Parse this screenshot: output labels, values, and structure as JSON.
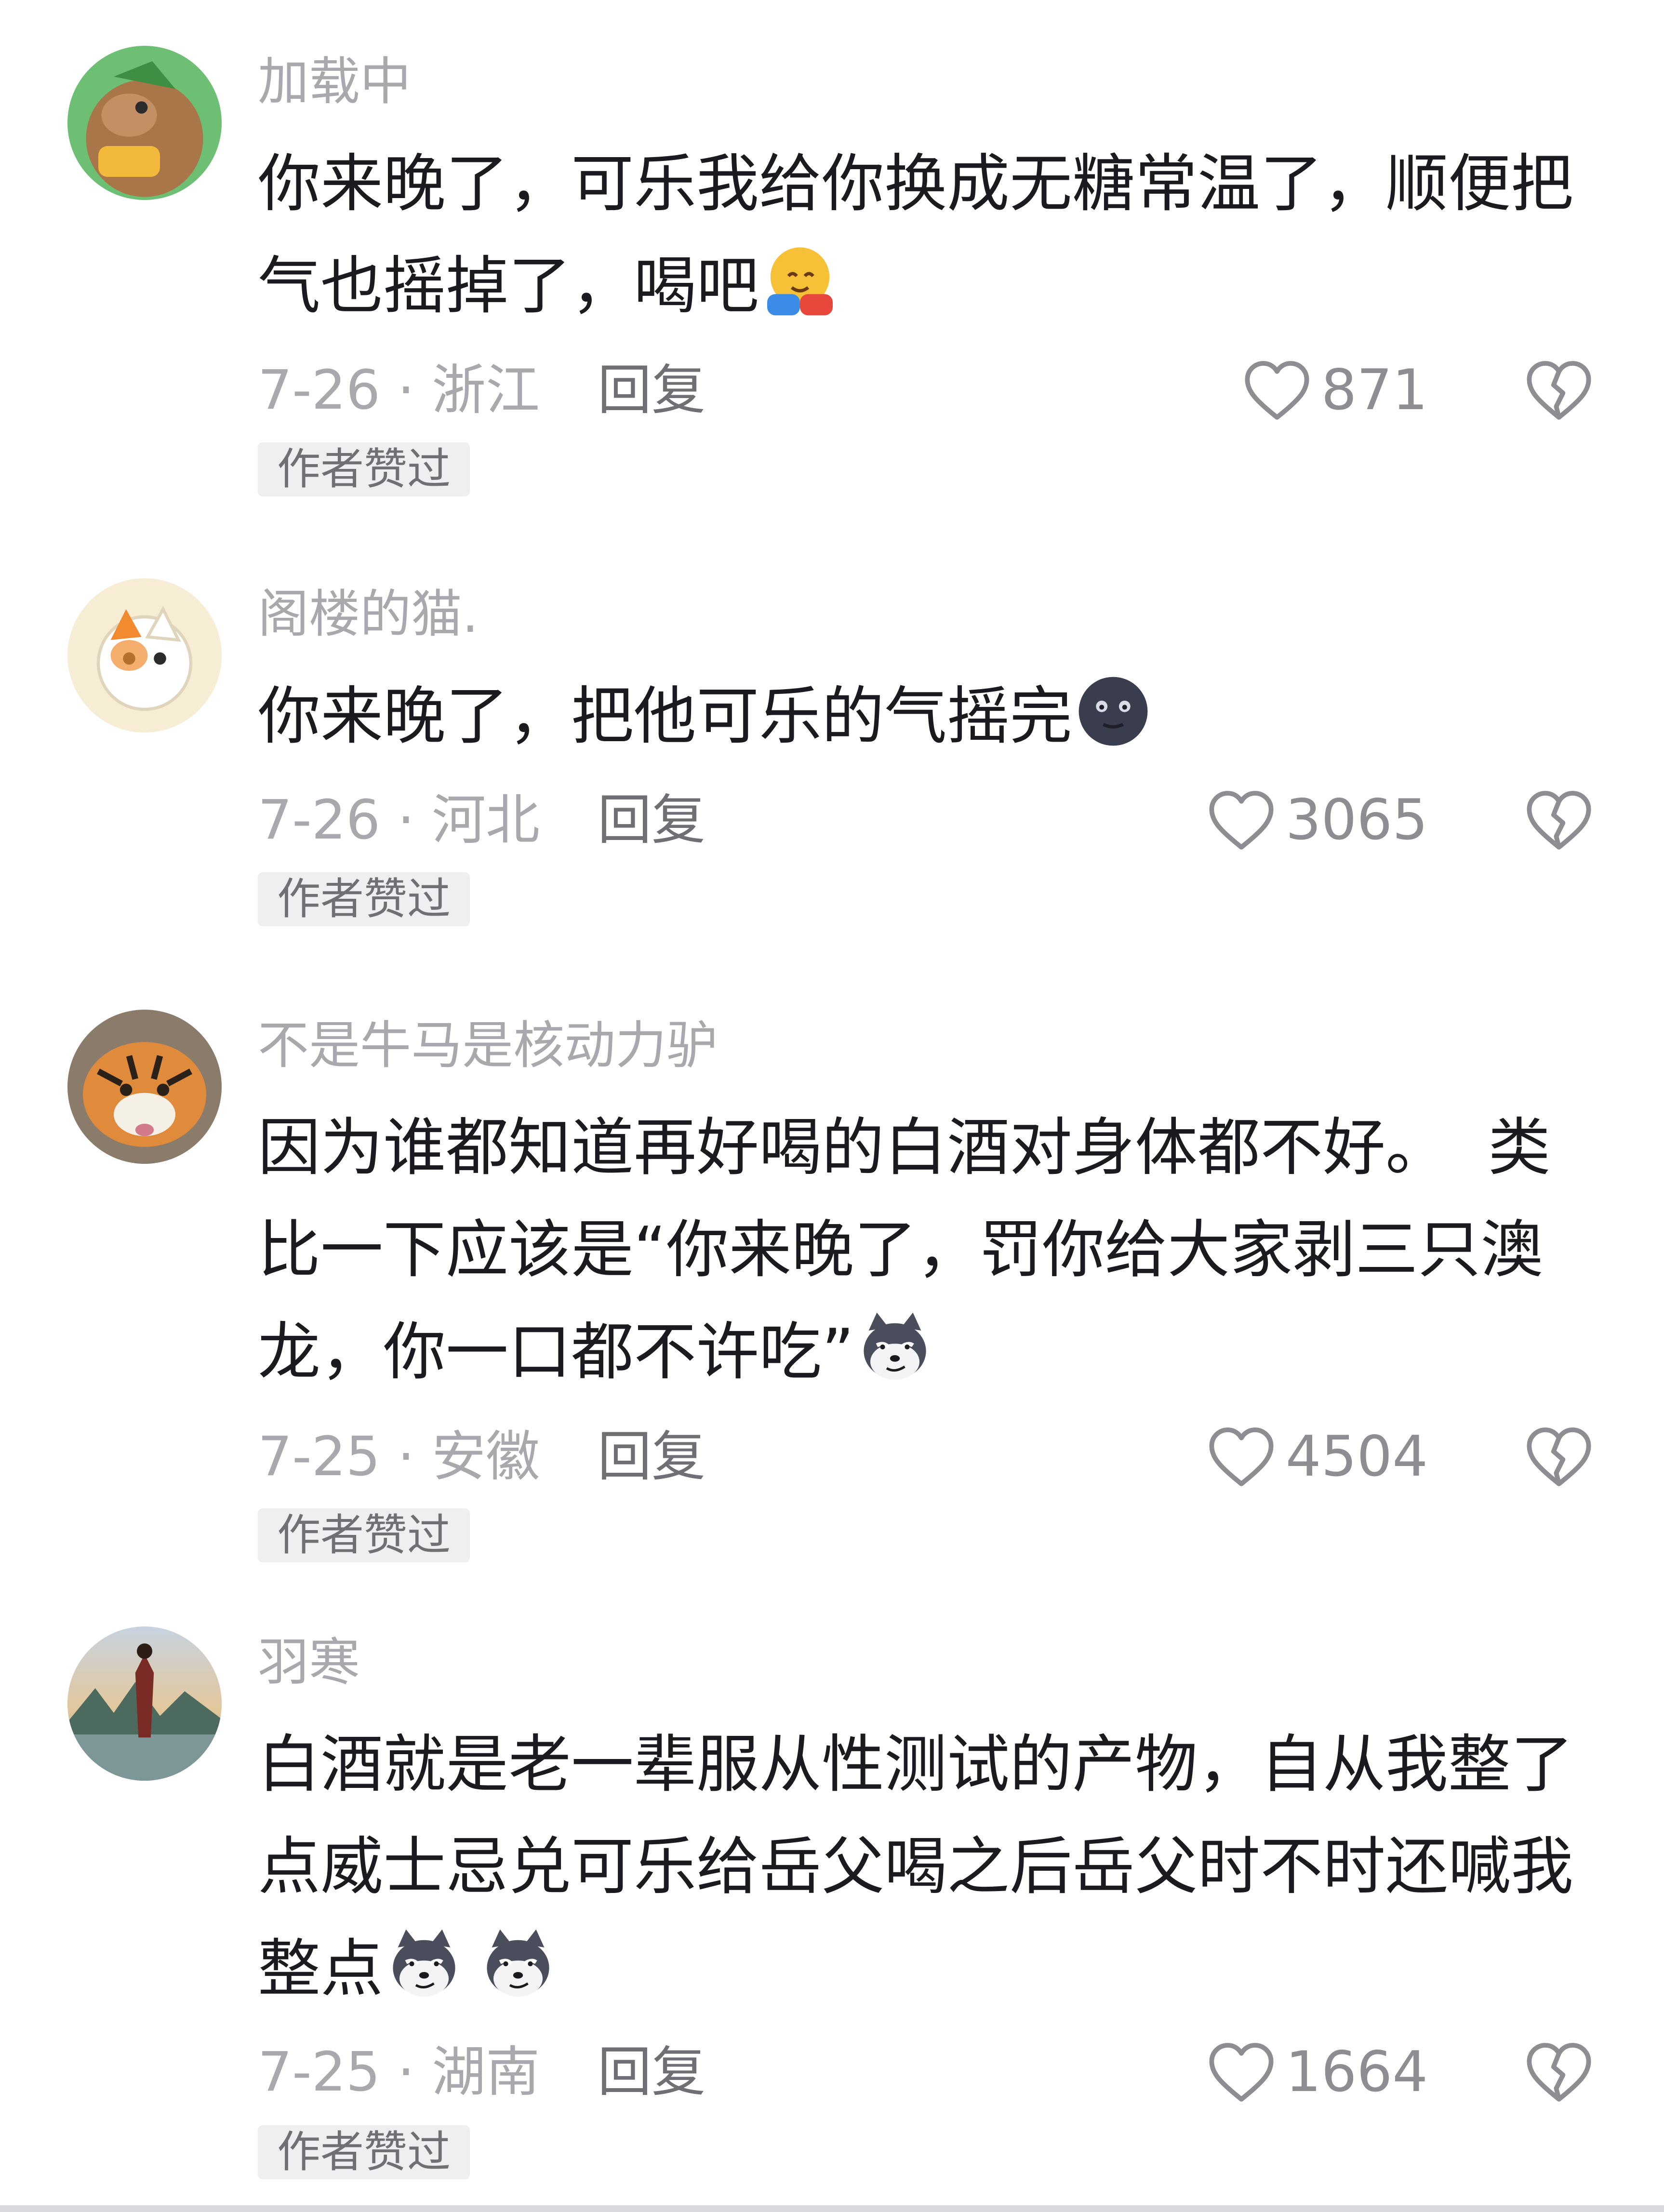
{
  "comments": [
    {
      "username": "加载中",
      "lines": [
        "你来晚了，可乐我给你换成无糖常温了，顺便把",
        "气也摇掉了，喝吧"
      ],
      "emojis": [
        "hugging-face-emoji"
      ],
      "date_location": "7-26 · 浙江",
      "reply_label": "回复",
      "likes": "871",
      "badge": "作者赞过"
    },
    {
      "username": "阁楼的猫.",
      "lines": [
        "你来晚了，把他可乐的气摇完"
      ],
      "emojis": [
        "new-moon-face-emoji"
      ],
      "date_location": "7-26 · 河北",
      "reply_label": "回复",
      "likes": "3065",
      "badge": "作者赞过"
    },
    {
      "username": "不是牛马是核动力驴",
      "lines": [
        "因为谁都知道再好喝的白酒对身体都不好。  类",
        "比一下应该是“你来晚了，罚你给大家剥三只澳",
        "龙，你一口都不许吃”"
      ],
      "emojis": [
        "smug-dog-emoji"
      ],
      "date_location": "7-25 · 安徽",
      "reply_label": "回复",
      "likes": "4504",
      "badge": "作者赞过"
    },
    {
      "username": "羽寒",
      "lines": [
        "白酒就是老一辈服从性测试的产物，自从我整了",
        "点威士忌兑可乐给岳父喝之后岳父时不时还喊我",
        "整点"
      ],
      "emojis": [
        "smug-dog-emoji",
        "smug-dog-emoji"
      ],
      "date_location": "7-25 · 湖南",
      "reply_label": "回复",
      "likes": "1664",
      "badge": "作者赞过"
    }
  ],
  "icons": {
    "like": "heart-outline-icon",
    "dislike": "broken-heart-outline-icon"
  },
  "colors": {
    "text_primary": "#1b1b1f",
    "text_secondary": "#a9a9ad",
    "badge_bg": "#efeff1"
  }
}
